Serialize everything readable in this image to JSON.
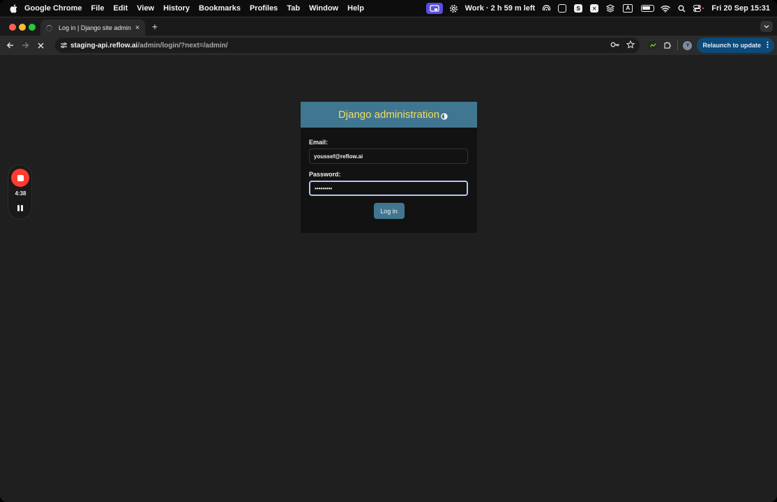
{
  "menubar": {
    "app_name": "Google Chrome",
    "items": [
      "File",
      "Edit",
      "View",
      "History",
      "Bookmarks",
      "Profiles",
      "Tab",
      "Window",
      "Help"
    ],
    "focus_status": "Work · 2 h 59 m left",
    "keyboard_indicator": "A",
    "clock": "Fri 20 Sep  15:31"
  },
  "browser": {
    "tab_title": "Log in | Django site admin",
    "tab_close": "×",
    "new_tab": "+",
    "url_host": "staging-api.reflow.ai",
    "url_path": "/admin/login/?next=/admin/",
    "avatar_letter": "Y",
    "relaunch_label": "Relaunch to update"
  },
  "page": {
    "site_title": "Django administration",
    "email_label": "Email:",
    "email_value": "youssef@reflow.ai",
    "password_label": "Password:",
    "password_value": "•••••••••",
    "login_label": "Log in"
  },
  "recorder": {
    "elapsed": "4:38"
  },
  "colors": {
    "header_bg": "#417690",
    "header_title": "#f5dd5d",
    "rec_red": "#ff3b30",
    "relaunch_bg": "#0d4a77"
  }
}
